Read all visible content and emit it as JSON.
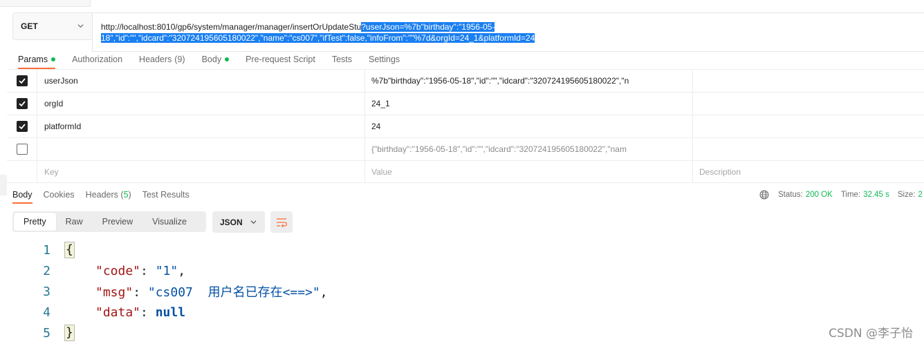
{
  "request": {
    "method": "GET",
    "url_plain": "http://localhost:8010/gp6/system/manager/manager/insertOrUpdateStu",
    "url_selected_line1": "?userJson=%7b\"birthday\":\"1956-05-",
    "url_selected_line2": "18\",\"id\":\"\",\"idcard\":\"320724195605180022\",\"name\":\"cs007\",\"ifTest\":false,\"infoFrom\":\"\"%7d&orgId=24_1&platformId=24"
  },
  "request_tabs": [
    {
      "label": "Params",
      "count": "",
      "dot": true,
      "active": true
    },
    {
      "label": "Authorization",
      "count": "",
      "dot": false,
      "active": false
    },
    {
      "label": "Headers",
      "count": "(9)",
      "dot": false,
      "active": false
    },
    {
      "label": "Body",
      "count": "",
      "dot": true,
      "active": false
    },
    {
      "label": "Pre-request Script",
      "count": "",
      "dot": false,
      "active": false
    },
    {
      "label": "Tests",
      "count": "",
      "dot": false,
      "active": false
    },
    {
      "label": "Settings",
      "count": "",
      "dot": false,
      "active": false
    }
  ],
  "params": {
    "rows": [
      {
        "checked": true,
        "key": "userJson",
        "value": "%7b\"birthday\":\"1956-05-18\",\"id\":\"\",\"idcard\":\"320724195605180022\",\"n"
      },
      {
        "checked": true,
        "key": "orgId",
        "value": "24_1"
      },
      {
        "checked": true,
        "key": "platformId",
        "value": "24"
      },
      {
        "checked": false,
        "key": "",
        "value": "{\"birthday\":\"1956-05-18\",\"id\":\"\",\"idcard\":\"320724195605180022\",\"nam"
      }
    ],
    "placeholders": {
      "key": "Key",
      "value": "Value",
      "description": "Description"
    }
  },
  "response_tabs": [
    {
      "label": "Body",
      "count": "",
      "active": true
    },
    {
      "label": "Cookies",
      "count": "",
      "active": false
    },
    {
      "label": "Headers",
      "count": "5",
      "active": false
    },
    {
      "label": "Test Results",
      "count": "",
      "active": false
    }
  ],
  "status": {
    "status_label": "Status:",
    "status_value": "200 OK",
    "time_label": "Time:",
    "time_value": "32.45 s",
    "size_label": "Size:",
    "size_value": "2"
  },
  "format": {
    "views": [
      "Pretty",
      "Raw",
      "Preview",
      "Visualize"
    ],
    "active_view": "Pretty",
    "language": "JSON"
  },
  "response_body": {
    "line_numbers": [
      "1",
      "2",
      "3",
      "4",
      "5"
    ],
    "open_brace": "{",
    "close_brace": "}",
    "code_key": "\"code\"",
    "code_value": "\"1\"",
    "msg_key": "\"msg\"",
    "msg_value_prefix": "\"cs007  ",
    "msg_value_cjk": "用户名已存在",
    "msg_value_suffix": "<==>\"",
    "data_key": "\"data\"",
    "data_value": "null"
  },
  "watermark": "CSDN @李子怡",
  "colors": {
    "accent_tab_underline": "#ff6c37",
    "success_green": "#0cbb52",
    "selection_blue": "#1a7ff0",
    "json_key": "#a31515",
    "json_string": "#0451a5",
    "line_number": "#237893"
  },
  "icons": [
    "chevron-down-icon",
    "check-icon",
    "globe-icon",
    "wrap-lines-icon"
  ]
}
